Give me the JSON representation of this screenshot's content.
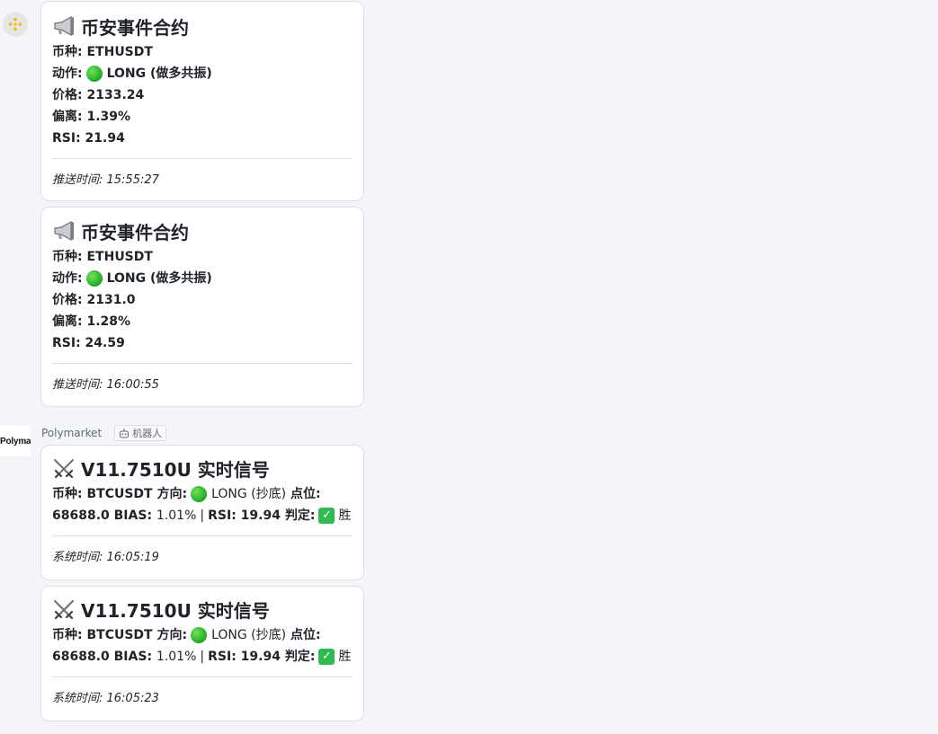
{
  "binance_sender": {
    "avatar_icon": "binance-logo-icon"
  },
  "binance_messages": [
    {
      "title": "币安事件合约",
      "symbol_label": "币种:",
      "symbol": "ETHUSDT",
      "action_label": "动作:",
      "action": "LONG (做多共振)",
      "price_label": "价格:",
      "price": "2133.24",
      "deviation_label": "偏离:",
      "deviation": "1.39%",
      "rsi_label": "RSI:",
      "rsi": "21.94",
      "push_time": "推送时间: 15:55:27"
    },
    {
      "title": "币安事件合约",
      "symbol_label": "币种:",
      "symbol": "ETHUSDT",
      "action_label": "动作:",
      "action": "LONG (做多共振)",
      "price_label": "价格:",
      "price": "2131.0",
      "deviation_label": "偏离:",
      "deviation": "1.28%",
      "rsi_label": "RSI:",
      "rsi": "24.59",
      "push_time": "推送时间: 16:00:55"
    }
  ],
  "poly_sender": {
    "avatar_text": "Polymar",
    "name": "Polymarket",
    "bot_tag": "机器人"
  },
  "poly_messages": [
    {
      "title": "V11.7510U 实时信号",
      "coin_label": "币种:",
      "coin": "BTCUSDT",
      "direction_label": "方向:",
      "direction": "LONG (抄底)",
      "level_label": "点位:",
      "level": "68688.0",
      "bias_label": "BIAS:",
      "bias": "1.01%",
      "separator": "|",
      "rsi_label": "RSI:",
      "rsi": "19.94",
      "verdict_label": "判定:",
      "verdict": "胜",
      "system_time": "系统时间: 16:05:19"
    },
    {
      "title": "V11.7510U 实时信号",
      "coin_label": "币种:",
      "coin": "BTCUSDT",
      "direction_label": "方向:",
      "direction": "LONG (抄底)",
      "level_label": "点位:",
      "level": "68688.0",
      "bias_label": "BIAS:",
      "bias": "1.01%",
      "separator": "|",
      "rsi_label": "RSI:",
      "rsi": "19.94",
      "verdict_label": "判定:",
      "verdict": "胜",
      "system_time": "系统时间: 16:05:23"
    }
  ],
  "colors": {
    "background": "#f4f5f8",
    "card": "#ffffff",
    "border": "#dee0e3",
    "green_dot": "#1fa826",
    "check_green": "#2fbb4f",
    "binance_gold": "#f0b90b"
  },
  "icons": {
    "binance_title": "megaphone-icon",
    "poly_title": "crossed-swords-icon",
    "status": "green-circle-icon",
    "verdict": "check-mark-button-icon",
    "bot": "robot-icon"
  }
}
